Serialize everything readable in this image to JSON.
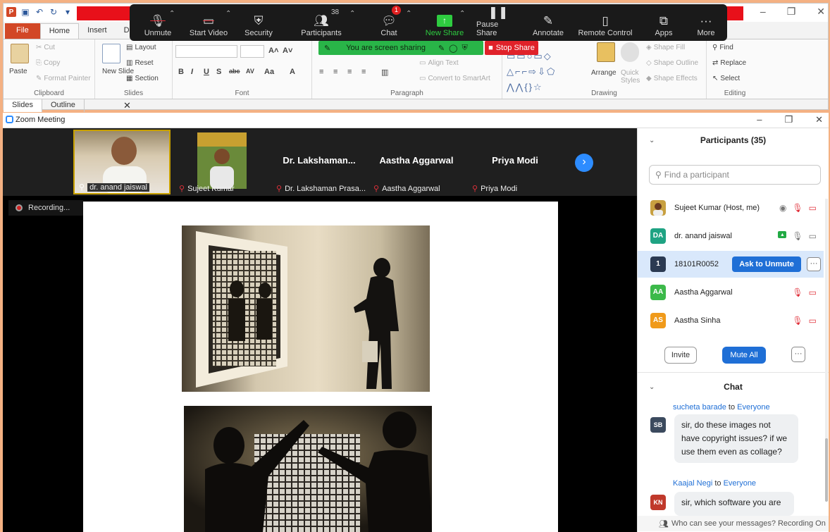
{
  "ppt": {
    "tabs": [
      "File",
      "Home",
      "Insert",
      "Des"
    ],
    "ribbon": {
      "paste": "Paste",
      "cut": "Cut",
      "copy": "Copy",
      "format_painter": "Format Painter",
      "new_slide": "New Slide",
      "layout": "Layout",
      "reset": "Reset",
      "section": "Section",
      "align_text": "Align Text",
      "convert_smartart": "Convert to SmartArt",
      "arrange": "Arrange",
      "quick_styles": "Quick Styles",
      "shape_fill": "Shape Fill",
      "shape_outline": "Shape Outline",
      "shape_effects": "Shape Effects",
      "find": "Find",
      "replace": "Replace",
      "select": "Select",
      "groups": [
        "Clipboard",
        "Slides",
        "Font",
        "Paragraph",
        "Drawing",
        "Editing"
      ]
    },
    "side_tabs": [
      "Slides",
      "Outline"
    ]
  },
  "zoom_toolbar": {
    "buttons": [
      "Unmute",
      "Start Video",
      "Security",
      "Participants",
      "Chat",
      "New Share",
      "Pause Share",
      "Annotate",
      "Remote Control",
      "Apps",
      "More"
    ],
    "participant_count": "38",
    "chat_badge": "1",
    "sharing_text": "You are screen sharing",
    "stop_share": "Stop Share"
  },
  "meeting": {
    "title": "Zoom Meeting",
    "recording": "Recording...",
    "gallery": [
      {
        "big": "",
        "name": "dr. anand jaiswal"
      },
      {
        "big": "",
        "name": "Sujeet Kumar"
      },
      {
        "big": "Dr. Lakshaman...",
        "name": "Dr. Lakshaman Prasa..."
      },
      {
        "big": "Aastha Aggarwal",
        "name": "Aastha Aggarwal"
      },
      {
        "big": "Priya Modi",
        "name": "Priya Modi"
      }
    ]
  },
  "participants": {
    "title": "Participants (35)",
    "search_placeholder": "Find a participant",
    "list": [
      {
        "initials": "",
        "name": "Sujeet Kumar (Host, me)",
        "color": "#b07030"
      },
      {
        "initials": "DA",
        "name": "dr. anand jaiswal",
        "color": "#1fa383"
      },
      {
        "initials": "1",
        "name": "18101R0052",
        "color": "#2b3a52"
      },
      {
        "initials": "AA",
        "name": "Aastha Aggarwal",
        "color": "#3cb94a"
      },
      {
        "initials": "AS",
        "name": "Aastha Sinha",
        "color": "#f09a1a"
      }
    ],
    "ask_unmute": "Ask to Unmute",
    "invite": "Invite",
    "mute_all": "Mute All"
  },
  "chat": {
    "title": "Chat",
    "to_label": "to",
    "messages": [
      {
        "initials": "SB",
        "from": "sucheta barade",
        "to": "Everyone",
        "color": "#3b4a5e",
        "lines": [
          "sir, do these  images not",
          "have copyright issues? if we",
          "use them even as collage?"
        ]
      },
      {
        "initials": "KN",
        "from": "Kaajal Negi",
        "to": "Everyone",
        "color": "#c0392b",
        "lines": [
          "sir, which software you are"
        ]
      }
    ],
    "footer": "Who can see your messages? Recording On"
  }
}
